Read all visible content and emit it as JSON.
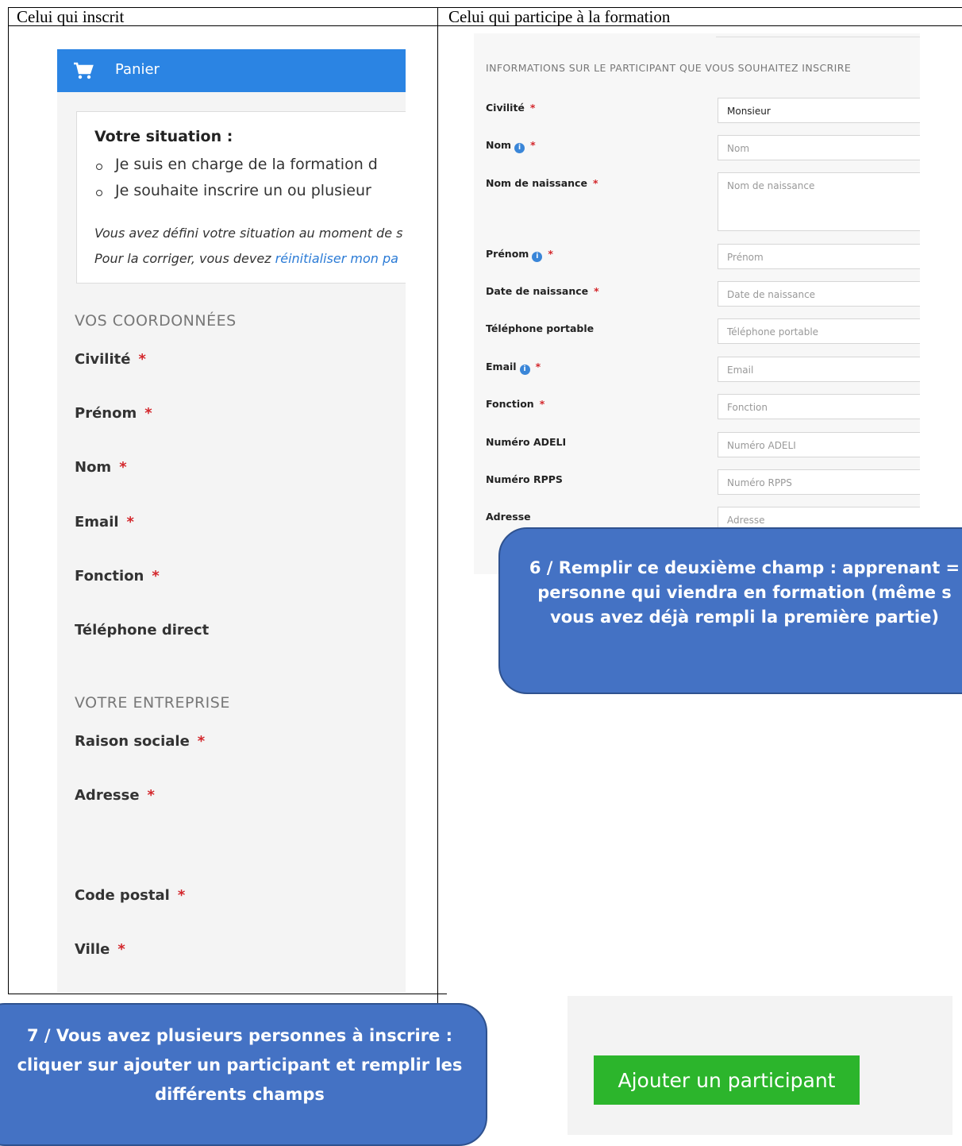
{
  "table": {
    "col_left_title": "Celui qui inscrit",
    "col_right_title": "Celui qui participe à la formation"
  },
  "left": {
    "header": {
      "icon": "cart-icon",
      "label": "Panier",
      "color": "#2b84e3"
    },
    "situation": {
      "title": "Votre situation :",
      "items": [
        "Je suis en charge de la formation d",
        "Je souhaite inscrire un ou plusieur"
      ],
      "note_line1": "Vous avez défini votre situation au moment de s",
      "note_line2_prefix": "Pour la corriger, vous devez ",
      "note_link": "réinitialiser mon pa"
    },
    "coordonnees_title": "VOS COORDONNÉES",
    "coordonnees_fields": [
      {
        "label": "Civilité",
        "required": "*"
      },
      {
        "label": "Prénom",
        "required": "*"
      },
      {
        "label": "Nom",
        "required": "*"
      },
      {
        "label": "Email",
        "required": "*"
      },
      {
        "label": "Fonction",
        "required": "*"
      },
      {
        "label": "Téléphone direct",
        "required": ""
      }
    ],
    "entreprise_title": "VOTRE ENTREPRISE",
    "entreprise_fields": [
      {
        "label": "Raison sociale",
        "required": "*"
      },
      {
        "label": "Adresse",
        "required": "*"
      },
      {
        "label": "Code postal",
        "required": "*"
      },
      {
        "label": "Ville",
        "required": "*"
      }
    ]
  },
  "right": {
    "section_title": "INFORMATIONS SUR LE PARTICIPANT QUE VOUS SOUHAITEZ INSCRIRE",
    "fields": [
      {
        "label": "Civilité",
        "required": "*",
        "value": "Monsieur",
        "placeholder": ""
      },
      {
        "label": "Nom",
        "required": "*",
        "info": "i",
        "value": "",
        "placeholder": "Nom"
      },
      {
        "label": "Nom de naissance",
        "required": "*",
        "value": "",
        "placeholder": "Nom de naissance"
      },
      {
        "label": "Prénom",
        "required": "*",
        "info": "i",
        "value": "",
        "placeholder": "Prénom"
      },
      {
        "label": "Date de naissance",
        "required": "*",
        "value": "",
        "placeholder": "Date de naissance"
      },
      {
        "label": "Téléphone portable",
        "required": "",
        "value": "",
        "placeholder": "Téléphone portable"
      },
      {
        "label": "Email",
        "required": "*",
        "info": "i",
        "value": "",
        "placeholder": "Email"
      },
      {
        "label": "Fonction",
        "required": "*",
        "value": "",
        "placeholder": "Fonction"
      },
      {
        "label": "Numéro ADELI",
        "required": "",
        "value": "",
        "placeholder": "Numéro ADELI"
      },
      {
        "label": "Numéro RPPS",
        "required": "",
        "value": "",
        "placeholder": "Numéro RPPS"
      },
      {
        "label": "Adresse",
        "required": "",
        "value": "",
        "placeholder": "Adresse"
      }
    ]
  },
  "callout6": {
    "line1": "6 / Remplir ce deuxième champ : apprenant =",
    "line2": "personne qui viendra en formation (même s",
    "line3": "vous avez déjà rempli la première partie)"
  },
  "callout7": {
    "line1": "7 / Vous avez plusieurs personnes à inscrire :",
    "line2": "cliquer sur ajouter un participant et remplir les",
    "line3": "différents champs"
  },
  "add_button": {
    "label": "Ajouter un participant",
    "color": "#2cb52c"
  },
  "colors": {
    "required": "#d3262b",
    "callout": "#4472c4",
    "link": "#2b7bd6"
  }
}
